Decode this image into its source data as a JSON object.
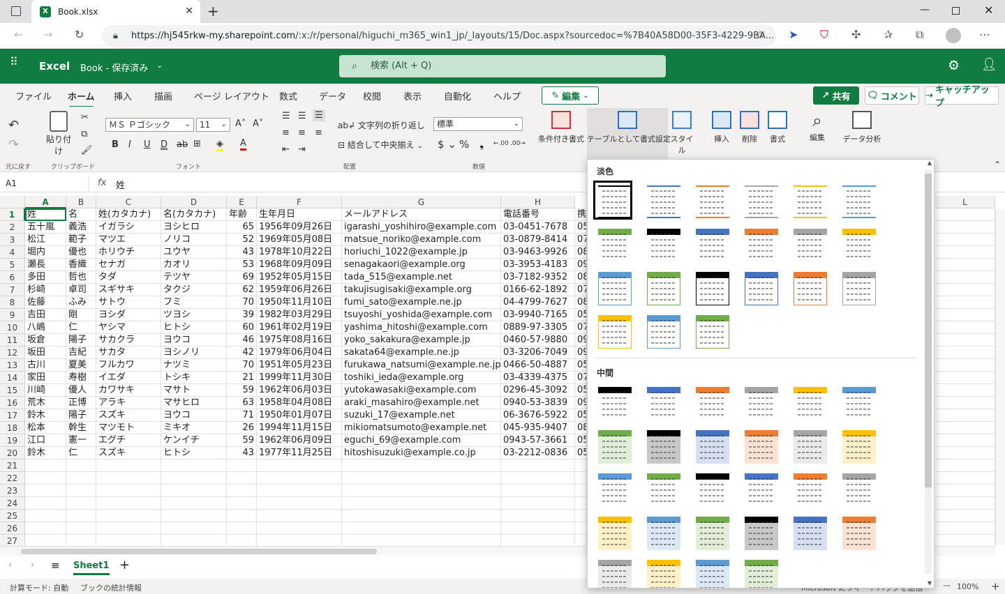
{
  "browser": {
    "tab_title": "Book.xlsx",
    "url_host": "https://hj545rkw-my.sharepoint.com",
    "url_path": "/:x:/r/personal/higuchi_m365_win1_jp/_layouts/15/Doc.aspx?sourcedoc=%7B40A58D00-35F3-4229-9BA..."
  },
  "app": {
    "name": "Excel",
    "doc_title": "Book - 保存済み",
    "search_placeholder": "検索 (Alt + Q)"
  },
  "ribbon_tabs": [
    "ファイル",
    "ホーム",
    "挿入",
    "描画",
    "ページ レイアウト",
    "数式",
    "データ",
    "校閲",
    "表示",
    "自動化",
    "ヘルプ"
  ],
  "edit_button": "編集",
  "share_button": "共有",
  "comment_button": "コメント",
  "catchup_button": "キャッチアップ",
  "ribbon": {
    "undo_group": "元に戻す",
    "paste_label": "貼り付け",
    "clipboard_group": "クリップボード",
    "font_name": "ＭＳ Ｐゴシック",
    "font_size": "11",
    "font_group": "フォント",
    "wrap_text": "文字列の折り返し",
    "merge_center": "結合して中央揃え",
    "align_group": "配置",
    "number_format": "標準",
    "number_group": "数値",
    "cond_format": "条件付き書式",
    "format_as_table": "テーブルとして書式設定",
    "cell_styles": "スタイル",
    "insert": "挿入",
    "delete": "削除",
    "format": "書式",
    "editing": "編集",
    "analyze": "データ分析"
  },
  "formula_bar": {
    "name_box": "A1",
    "fx": "fx",
    "value": "姓"
  },
  "columns": [
    "A",
    "B",
    "C",
    "D",
    "E",
    "F",
    "G",
    "H",
    "L"
  ],
  "rows": [
    "1",
    "2",
    "3",
    "4",
    "5",
    "6",
    "7",
    "8",
    "9",
    "10",
    "11",
    "12",
    "13",
    "14",
    "15",
    "16",
    "17",
    "18",
    "19",
    "20",
    "21",
    "22",
    "23",
    "24",
    "25",
    "26",
    "27"
  ],
  "table": {
    "headers": [
      "姓",
      "名",
      "姓(カタカナ)",
      "名(カタカナ)",
      "年齢",
      "生年月日",
      "メールアドレス",
      "電話番号",
      "携"
    ],
    "rows": [
      [
        "五十嵐",
        "義浩",
        "イガラシ",
        "ヨシヒロ",
        "65",
        "1956年09月26日",
        "igarashi_yoshihiro@example.com",
        "03-0451-7678",
        "05"
      ],
      [
        "松江",
        "範子",
        "マツエ",
        "ノリコ",
        "52",
        "1969年05月08日",
        "matsue_noriko@example.com",
        "03-0879-8414",
        "07"
      ],
      [
        "堀内",
        "優也",
        "ホリウチ",
        "ユウヤ",
        "43",
        "1978年10月22日",
        "horiuchi_1022@example.jp",
        "03-9463-9926",
        "08"
      ],
      [
        "瀬長",
        "香織",
        "セナガ",
        "カオリ",
        "53",
        "1968年09月09日",
        "senagakaori@example.org",
        "03-3953-4183",
        "09"
      ],
      [
        "多田",
        "哲也",
        "タダ",
        "テツヤ",
        "69",
        "1952年05月15日",
        "tada_515@example.net",
        "03-7182-9352",
        "08"
      ],
      [
        "杉崎",
        "卓司",
        "スギサキ",
        "タクジ",
        "62",
        "1959年06月26日",
        "takujisugisaki@example.org",
        "0166-62-1892",
        "07"
      ],
      [
        "佐藤",
        "ふみ",
        "サトウ",
        "フミ",
        "70",
        "1950年11月10日",
        "fumi_sato@example.ne.jp",
        "04-4799-7627",
        "08"
      ],
      [
        "吉田",
        "剛",
        "ヨシダ",
        "ツヨシ",
        "39",
        "1982年03月29日",
        "tsuyoshi_yoshida@example.com",
        "03-9940-7165",
        "05"
      ],
      [
        "八嶋",
        "仁",
        "ヤシマ",
        "ヒトシ",
        "60",
        "1961年02月19日",
        "yashima_hitoshi@example.com",
        "0889-97-3305",
        "07"
      ],
      [
        "坂倉",
        "陽子",
        "サカクラ",
        "ヨウコ",
        "46",
        "1975年08月16日",
        "yoko_sakakura@example.jp",
        "0460-57-9880",
        "09"
      ],
      [
        "坂田",
        "吉紀",
        "サカタ",
        "ヨシノリ",
        "42",
        "1979年06月04日",
        "sakata64@example.ne.jp",
        "03-3206-7049",
        "09"
      ],
      [
        "古川",
        "夏美",
        "フルカワ",
        "ナツミ",
        "70",
        "1951年05月23日",
        "furukawa_natsumi@example.ne.jp",
        "0466-50-4887",
        "05"
      ],
      [
        "家田",
        "寿樹",
        "イエダ",
        "トシキ",
        "21",
        "1999年11月30日",
        "toshiki_ieda@example.org",
        "03-4339-4375",
        "07"
      ],
      [
        "川崎",
        "優人",
        "カワサキ",
        "マサト",
        "59",
        "1962年06月03日",
        "yutokawasaki@example.com",
        "0296-45-3092",
        "05"
      ],
      [
        "荒木",
        "正博",
        "アラキ",
        "マサヒロ",
        "63",
        "1958年04月08日",
        "araki_masahiro@example.net",
        "0940-53-3839",
        "09"
      ],
      [
        "鈴木",
        "陽子",
        "スズキ",
        "ヨウコ",
        "71",
        "1950年01月07日",
        "suzuki_17@example.net",
        "06-3676-5922",
        "05"
      ],
      [
        "松本",
        "幹生",
        "マツモト",
        "ミキオ",
        "26",
        "1994年11月15日",
        "mikiomatsumoto@example.net",
        "045-935-9407",
        "08"
      ],
      [
        "江口",
        "憲一",
        "エグチ",
        "ケンイチ",
        "59",
        "1962年06月09日",
        "eguchi_69@example.com",
        "0943-57-3661",
        "05"
      ],
      [
        "鈴木",
        "仁",
        "スズキ",
        "ヒトシ",
        "43",
        "1977年11月25日",
        "hitoshisuzuki@example.co.jp",
        "03-2212-0836",
        "05"
      ]
    ]
  },
  "sheet_tab": "Sheet1",
  "status": {
    "calc_mode": "計算モード: 自動",
    "workbook_stats": "ブックの統計情報",
    "feedback": "Microsoft にフィードバックを送信",
    "zoom": "100%"
  },
  "table_styles_dropdown": {
    "light_heading": "淡色",
    "medium_heading": "中間",
    "light_colors": [
      "#000000",
      "#4472c4",
      "#ed7d31",
      "#a5a5a5",
      "#ffc000",
      "#5b9bd5",
      "#70ad47",
      "#000000",
      "#4472c4",
      "#ed7d31",
      "#a5a5a5",
      "#ffc000",
      "#5b9bd5",
      "#70ad47",
      "#000000",
      "#4472c4",
      "#ed7d31",
      "#a5a5a5",
      "#ffc000",
      "#5b9bd5",
      "#70ad47"
    ],
    "medium_colors": [
      "#000000",
      "#4472c4",
      "#ed7d31",
      "#a5a5a5",
      "#ffc000",
      "#5b9bd5",
      "#70ad47",
      "#000000",
      "#4472c4",
      "#ed7d31",
      "#a5a5a5",
      "#ffc000",
      "#5b9bd5",
      "#70ad47",
      "#000000",
      "#4472c4",
      "#ed7d31",
      "#a5a5a5",
      "#ffc000",
      "#5b9bd5",
      "#70ad47",
      "#000000",
      "#4472c4",
      "#ed7d31",
      "#a5a5a5",
      "#ffc000",
      "#5b9bd5",
      "#70ad47"
    ]
  }
}
